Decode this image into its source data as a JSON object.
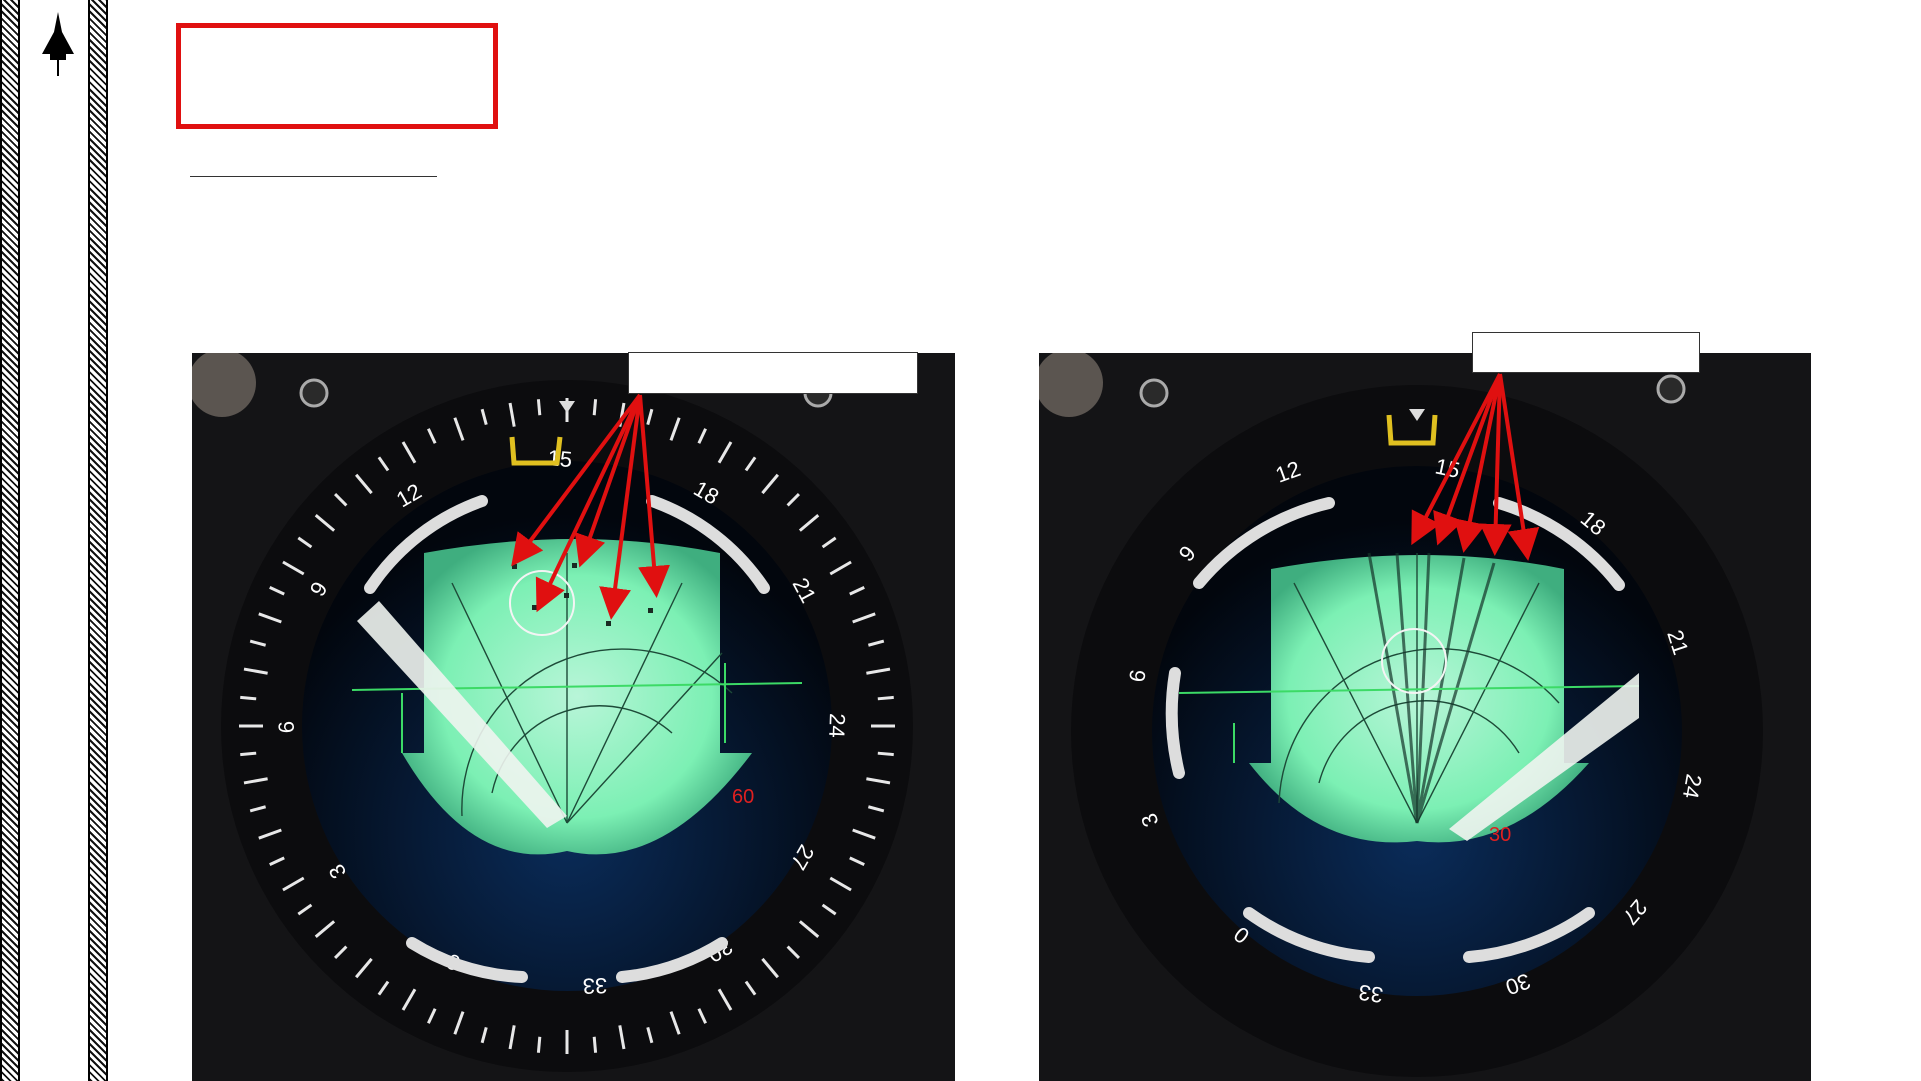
{
  "left_panel": {
    "bezel_numbers": [
      "15",
      "18",
      "21",
      "24",
      "27",
      "30",
      "33",
      "0",
      "3",
      "6",
      "9",
      "12"
    ],
    "range_readout": "60",
    "callout_text": ""
  },
  "right_panel": {
    "bezel_numbers": [
      "15",
      "18",
      "21",
      "24",
      "27",
      "30",
      "33",
      "0",
      "3",
      "6",
      "9",
      "12"
    ],
    "range_readout": "30",
    "callout_text": ""
  },
  "colors": {
    "accent_red": "#e01010",
    "scope_green": "#7cf0b4",
    "bezel_yellow": "#e0c020"
  }
}
